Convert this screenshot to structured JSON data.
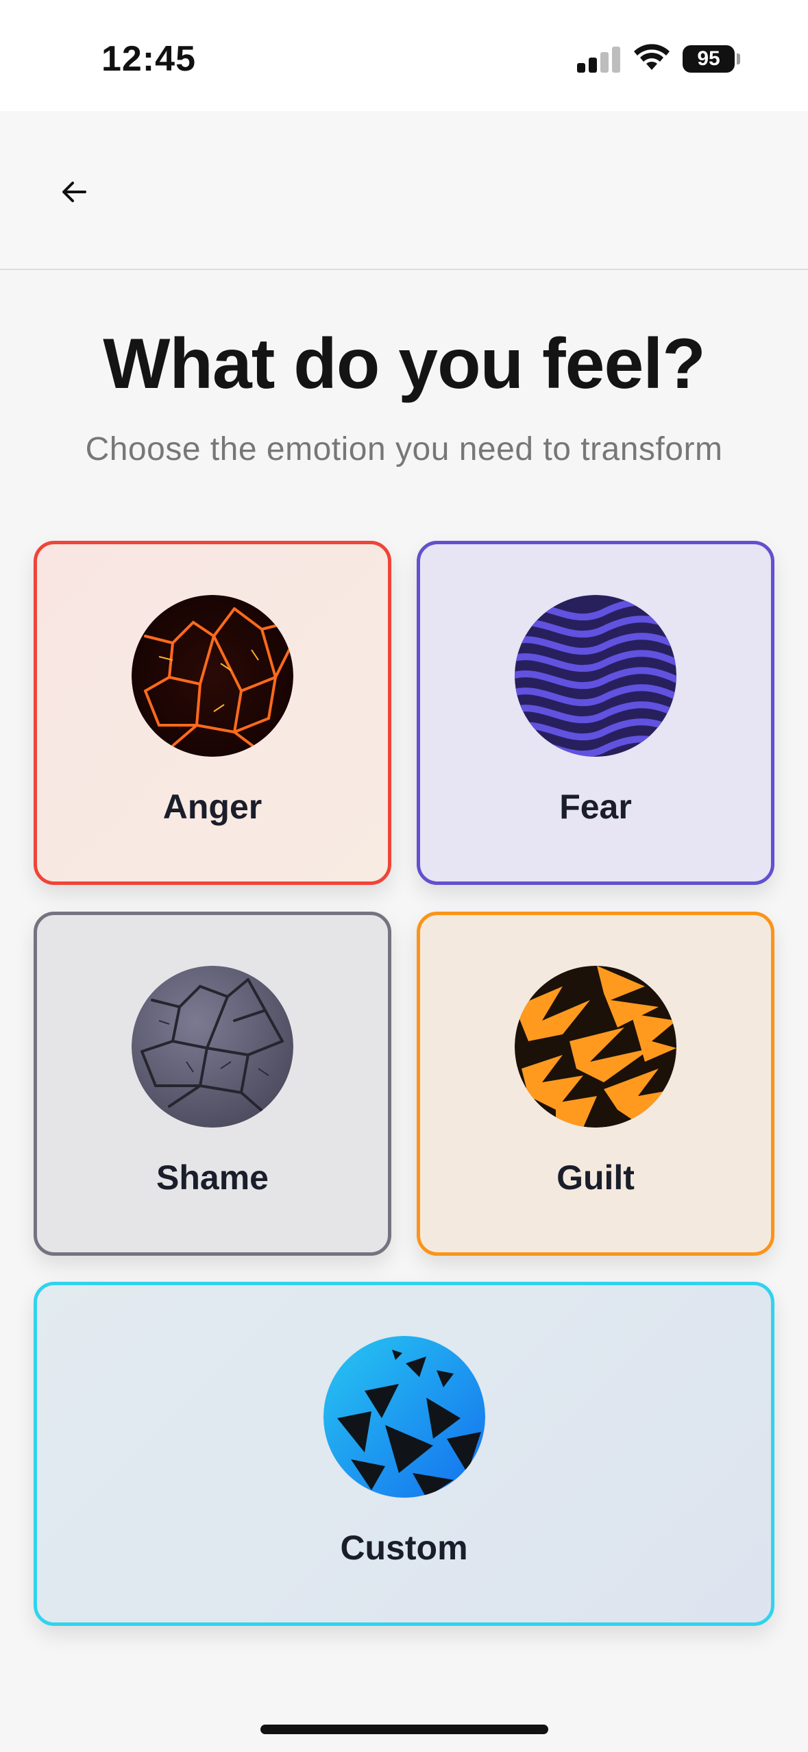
{
  "status_bar": {
    "time": "12:45",
    "battery": "95"
  },
  "header": {
    "back_icon": "arrow-left-icon"
  },
  "title": "What do you feel?",
  "subtitle": "Choose the emotion you need to transform",
  "emotions": [
    {
      "label": "Anger",
      "color": "#ef4438",
      "icon": "cracked-lava-orb-icon"
    },
    {
      "label": "Fear",
      "color": "#6150cf",
      "icon": "wavy-stripes-orb-icon"
    },
    {
      "label": "Shame",
      "color": "#75737f",
      "icon": "cracked-stone-orb-icon"
    },
    {
      "label": "Guilt",
      "color": "#fa9418",
      "icon": "zigzag-shards-orb-icon"
    },
    {
      "label": "Custom",
      "color": "#2fd3ee",
      "icon": "blue-shards-orb-icon"
    }
  ]
}
